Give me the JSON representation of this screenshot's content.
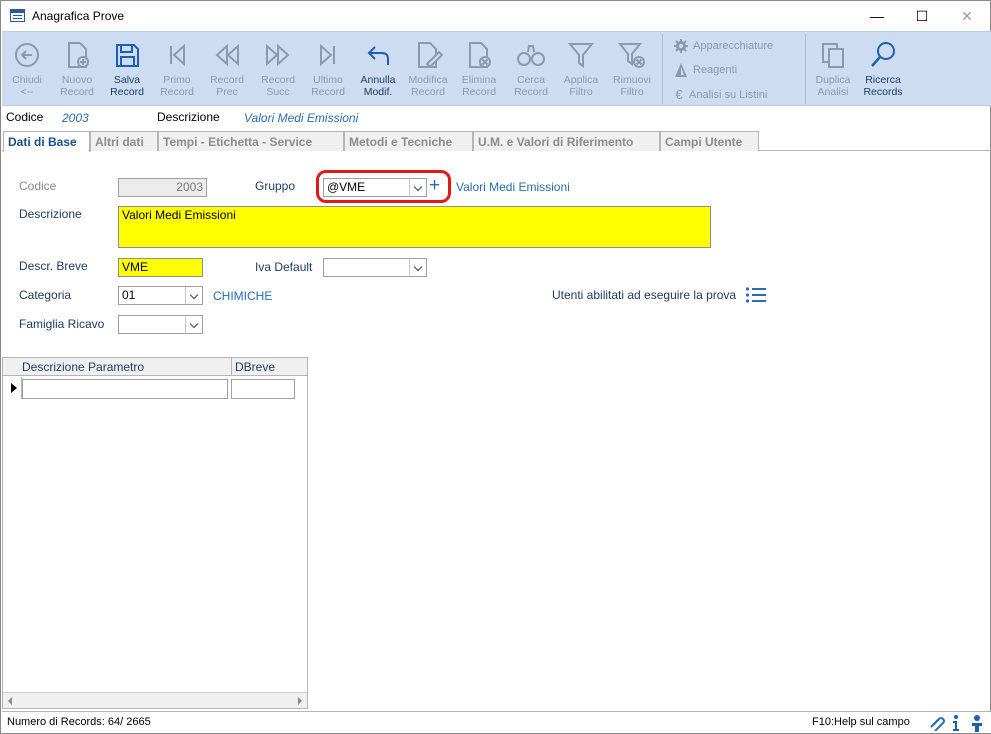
{
  "window": {
    "title": "Anagrafica Prove",
    "minimize_glyph": "—",
    "maximize_glyph": "☐",
    "close_glyph": "✕"
  },
  "toolbar": {
    "buttons": [
      {
        "line1": "Chiudi",
        "line2": "<--",
        "icon": "close-back-icon"
      },
      {
        "line1": "Nuovo",
        "line2": "Record",
        "icon": "new-record-icon"
      },
      {
        "line1": "Salva",
        "line2": "Record",
        "icon": "save-icon"
      },
      {
        "line1": "Primo",
        "line2": "Record",
        "icon": "first-record-icon"
      },
      {
        "line1": "Record",
        "line2": "Prec",
        "icon": "prev-record-icon"
      },
      {
        "line1": "Record",
        "line2": "Succ",
        "icon": "next-record-icon"
      },
      {
        "line1": "Ultimo",
        "line2": "Record",
        "icon": "last-record-icon"
      },
      {
        "line1": "Annulla",
        "line2": "Modif.",
        "icon": "undo-icon"
      },
      {
        "line1": "Modifica",
        "line2": "Record",
        "icon": "edit-record-icon"
      },
      {
        "line1": "Elimina",
        "line2": "Record",
        "icon": "delete-record-icon"
      },
      {
        "line1": "Cerca",
        "line2": "Record",
        "icon": "binoculars-icon"
      },
      {
        "line1": "Applica",
        "line2": "Filtro",
        "icon": "filter-icon"
      },
      {
        "line1": "Rimuovi",
        "line2": "Filtro",
        "icon": "remove-filter-icon"
      }
    ],
    "side_items": [
      {
        "label": "Apparecchiature",
        "icon": "gear-icon"
      },
      {
        "label": "Reagenti",
        "icon": "flask-icon"
      },
      {
        "label": "Analisi su Listini",
        "icon": "euro-icon"
      }
    ],
    "extra_buttons": [
      {
        "line1": "Duplica",
        "line2": "Analisi",
        "icon": "duplicate-icon"
      },
      {
        "line1": "Ricerca",
        "line2": "Records",
        "icon": "search-icon"
      }
    ]
  },
  "header": {
    "codice_label": "Codice",
    "codice_value": "2003",
    "descrizione_label": "Descrizione",
    "descrizione_value": "Valori Medi Emissioni"
  },
  "tabs": [
    {
      "label": "Dati di Base",
      "active": true
    },
    {
      "label": "Altri dati",
      "active": false
    },
    {
      "label": "Tempi - Etichetta - Service",
      "active": false
    },
    {
      "label": "Metodi e Tecniche",
      "active": false
    },
    {
      "label": "U.M. e Valori di Riferimento",
      "active": false
    },
    {
      "label": "Campi Utente",
      "active": false
    }
  ],
  "form": {
    "codice_label": "Codice",
    "codice_value": "2003",
    "gruppo_label": "Gruppo",
    "gruppo_value": "@VME",
    "gruppo_add_glyph": "+",
    "gruppo_desc": "Valori Medi Emissioni",
    "descrizione_label": "Descrizione",
    "descrizione_value": "Valori Medi Emissioni",
    "descr_breve_label": "Descr. Breve",
    "descr_breve_value": "VME",
    "iva_label": "Iva Default",
    "iva_value": "",
    "categoria_label": "Categoria",
    "categoria_value": "01",
    "categoria_desc": "CHIMICHE",
    "utenti_label": "Utenti abilitati ad eseguire la prova",
    "famiglia_label": "Famiglia Ricavo",
    "famiglia_value": ""
  },
  "grid": {
    "columns": [
      "Descrizione Parametro",
      "DBreve"
    ]
  },
  "status": {
    "records": "Numero di Records: 64/ 2665",
    "help": "F10:Help sul campo"
  },
  "colors": {
    "ribbon": "#cddcf0",
    "accent": "#2a6db0",
    "highlight": "#e01a1a",
    "required": "#ffff00"
  }
}
